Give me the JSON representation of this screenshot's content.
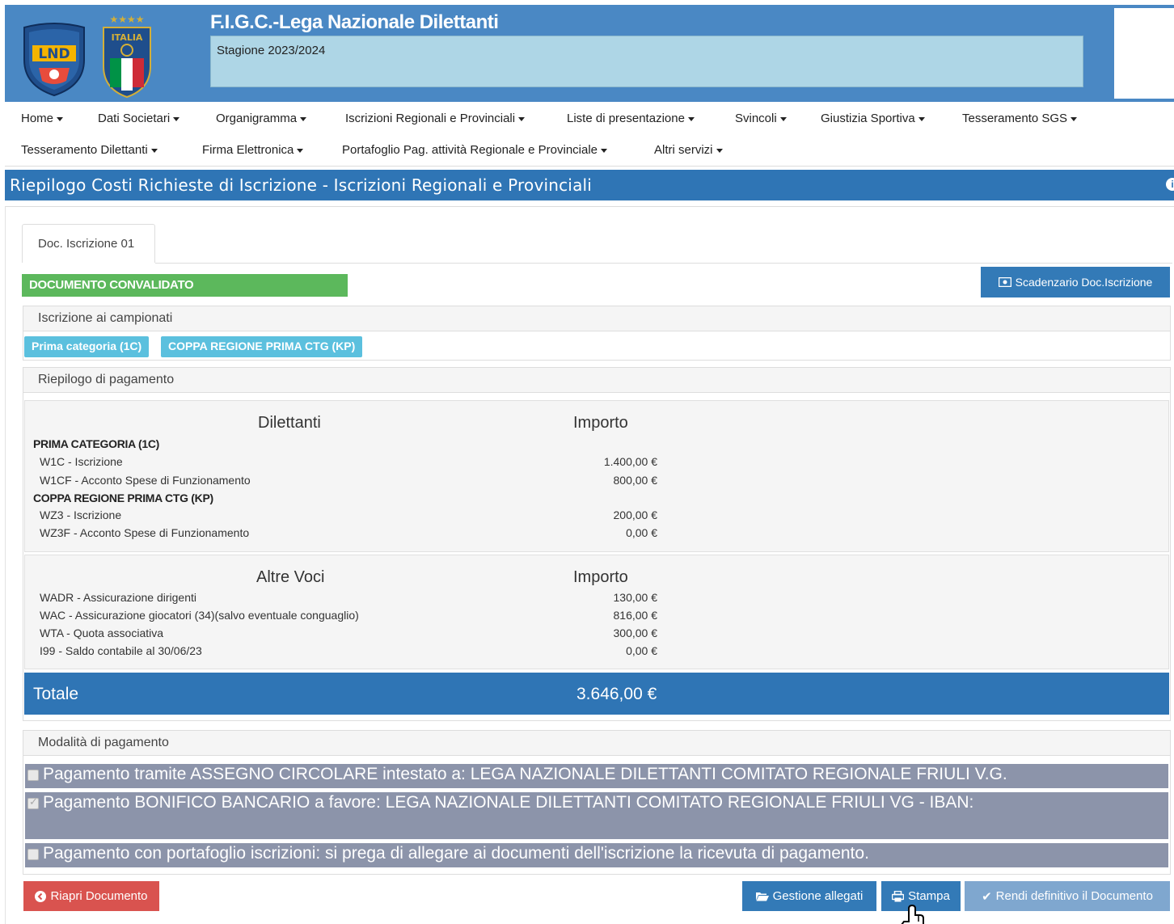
{
  "header": {
    "org_title": "F.I.G.C.-Lega Nazionale Dilettanti",
    "season": "Stagione 2023/2024",
    "logo_lnd_text": "LND",
    "logo_italia_text": "ITALIA"
  },
  "nav": {
    "row1": [
      "Home",
      "Dati Societari",
      "Organigramma",
      "Iscrizioni Regionali e Provinciali",
      "Liste di presentazione",
      "Svincoli",
      "Giustizia Sportiva",
      "Tesseramento SGS"
    ],
    "row2": [
      "Tesseramento Dilettanti",
      "Firma Elettronica",
      "Portafoglio Pag. attività Regionale e Provinciale",
      "Altri servizi"
    ]
  },
  "page": {
    "title": "Riepilogo Costi Richieste di Iscrizione - Iscrizioni Regionali e Provinciali"
  },
  "tab": {
    "label": "Doc. Iscrizione 01"
  },
  "status": {
    "label": "DOCUMENTO CONVALIDATO"
  },
  "buttons": {
    "scadenzario": "Scadenzario Doc.Iscrizione",
    "riapri": "Riapri Documento",
    "gestione_allegati": "Gestione allegati",
    "stampa": "Stampa",
    "rendi_definitivo": "Rendi definitivo il Documento"
  },
  "iscrizione": {
    "heading": "Iscrizione ai campionati",
    "labels": [
      "Prima categoria (1C)",
      "COPPA REGIONE PRIMA CTG (KP)"
    ]
  },
  "riepilogo": {
    "heading": "Riepilogo di pagamento",
    "dilettanti": {
      "col1": "Dilettanti",
      "col2": "Importo",
      "groups": [
        {
          "name": "PRIMA CATEGORIA (1C)",
          "rows": [
            {
              "label": "W1C - Iscrizione",
              "amount": "1.400,00 €"
            },
            {
              "label": "W1CF - Acconto Spese di Funzionamento",
              "amount": "800,00 €"
            }
          ]
        },
        {
          "name": "COPPA REGIONE PRIMA CTG (KP)",
          "rows": [
            {
              "label": "WZ3 - Iscrizione",
              "amount": "200,00 €"
            },
            {
              "label": "WZ3F - Acconto Spese di Funzionamento",
              "amount": "0,00 €"
            }
          ]
        }
      ]
    },
    "altre": {
      "col1": "Altre Voci",
      "col2": "Importo",
      "rows": [
        {
          "label": "WADR - Assicurazione dirigenti",
          "amount": "130,00 €"
        },
        {
          "label": "WAC - Assicurazione giocatori (34)(salvo eventuale conguaglio)",
          "amount": "816,00 €"
        },
        {
          "label": "WTA - Quota associativa",
          "amount": "300,00 €"
        },
        {
          "label": "I99 - Saldo contabile al 30/06/23",
          "amount": "0,00 €"
        }
      ]
    },
    "totale": {
      "label": "Totale",
      "amount": "3.646,00 €"
    }
  },
  "modalita": {
    "heading": "Modalità di pagamento",
    "options": [
      {
        "text": "Pagamento tramite ASSEGNO CIRCOLARE intestato a: LEGA NAZIONALE DILETTANTI COMITATO REGIONALE FRIULI V.G.",
        "checked": false
      },
      {
        "text": "Pagamento BONIFICO BANCARIO a favore: LEGA NAZIONALE DILETTANTI COMITATO REGIONALE FRIULI VG - IBAN:",
        "checked": true
      },
      {
        "text": "Pagamento con portafoglio iscrizioni: si prega di allegare ai documenti dell'iscrizione la ricevuta di pagamento.",
        "checked": false
      }
    ]
  },
  "colors": {
    "header_bg": "#4a88c4",
    "title_bar": "#2f75b5",
    "success": "#5cb85c",
    "info": "#5bc0de",
    "danger": "#d9534f",
    "primary": "#337ab7",
    "payment_row": "#8c94aa"
  }
}
